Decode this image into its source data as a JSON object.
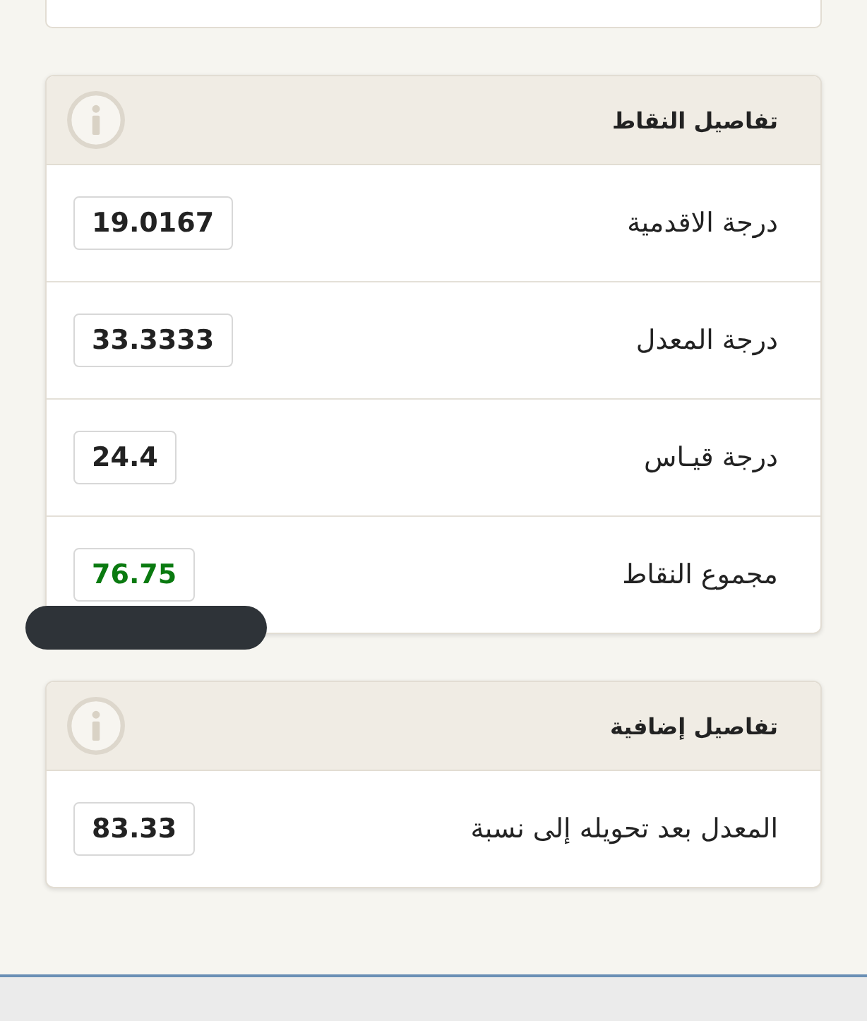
{
  "sections": [
    {
      "title": "تفاصيل النقاط",
      "rows": [
        {
          "label": "درجة الاقدمية",
          "value": "19.0167",
          "highlight": false
        },
        {
          "label": "درجة المعدل",
          "value": "33.3333",
          "highlight": false
        },
        {
          "label": "درجة قيـاس",
          "value": "24.4",
          "highlight": false
        },
        {
          "label": "مجموع النقاط",
          "value": "76.75",
          "highlight": true
        }
      ]
    },
    {
      "title": "تفاصيل إضافية",
      "rows": [
        {
          "label": "المعدل بعد تحويله إلى نسبة",
          "value": "83.33",
          "highlight": false
        }
      ]
    }
  ]
}
